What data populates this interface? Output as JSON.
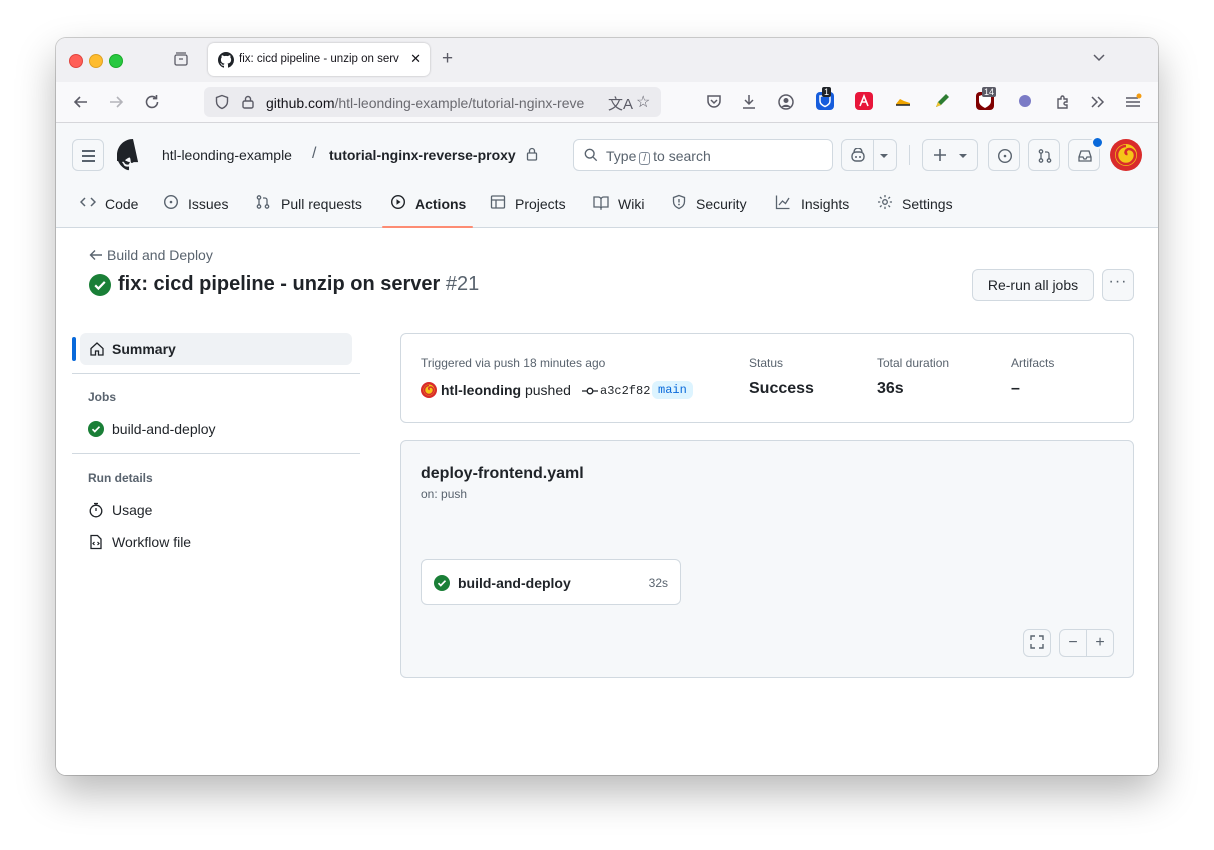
{
  "browser": {
    "tab_title": "fix: cicd pipeline - unzip on serv",
    "url_host": "github.com",
    "url_path": "/htl-leonding-example/tutorial-nginx-reve",
    "ext_badges": {
      "bitwarden": "1",
      "ublock": "14"
    }
  },
  "header": {
    "owner": "htl-leonding-example",
    "separator": "/",
    "repo": "tutorial-nginx-reverse-proxy",
    "search_prefix": "Type",
    "search_key": "/",
    "search_suffix": "to search"
  },
  "repo_tabs": [
    {
      "label": "Code",
      "icon": "code-icon"
    },
    {
      "label": "Issues",
      "icon": "issue-icon"
    },
    {
      "label": "Pull requests",
      "icon": "pull-request-icon"
    },
    {
      "label": "Actions",
      "icon": "play-icon",
      "selected": true
    },
    {
      "label": "Projects",
      "icon": "table-icon"
    },
    {
      "label": "Wiki",
      "icon": "book-icon"
    },
    {
      "label": "Security",
      "icon": "shield-icon"
    },
    {
      "label": "Insights",
      "icon": "graph-icon"
    },
    {
      "label": "Settings",
      "icon": "gear-icon"
    }
  ],
  "run": {
    "back_label": "Build and Deploy",
    "title": "fix: cicd pipeline - unzip on server",
    "number": "#21",
    "rerun_label": "Re-run all jobs",
    "more_label": "···"
  },
  "sidebar": {
    "summary_label": "Summary",
    "jobs_heading": "Jobs",
    "jobs": [
      {
        "label": "build-and-deploy",
        "status": "success"
      }
    ],
    "details_heading": "Run details",
    "details": [
      {
        "label": "Usage",
        "icon": "stopwatch-icon"
      },
      {
        "label": "Workflow file",
        "icon": "file-code-icon"
      }
    ]
  },
  "summary": {
    "triggered": "Triggered via push 18 minutes ago",
    "actor": "htl-leonding",
    "action": "pushed",
    "commit": "a3c2f82",
    "branch": "main",
    "status_label": "Status",
    "status_value": "Success",
    "duration_label": "Total duration",
    "duration_value": "36s",
    "artifacts_label": "Artifacts",
    "artifacts_value": "–"
  },
  "workflow": {
    "file": "deploy-frontend.yaml",
    "trigger": "on: push",
    "job_label": "build-and-deploy",
    "job_duration": "32s",
    "zoom_out": "−",
    "zoom_in": "+"
  },
  "colors": {
    "success": "#1a7f37",
    "accent": "#0969da",
    "tab_underline": "#fd8c73"
  }
}
